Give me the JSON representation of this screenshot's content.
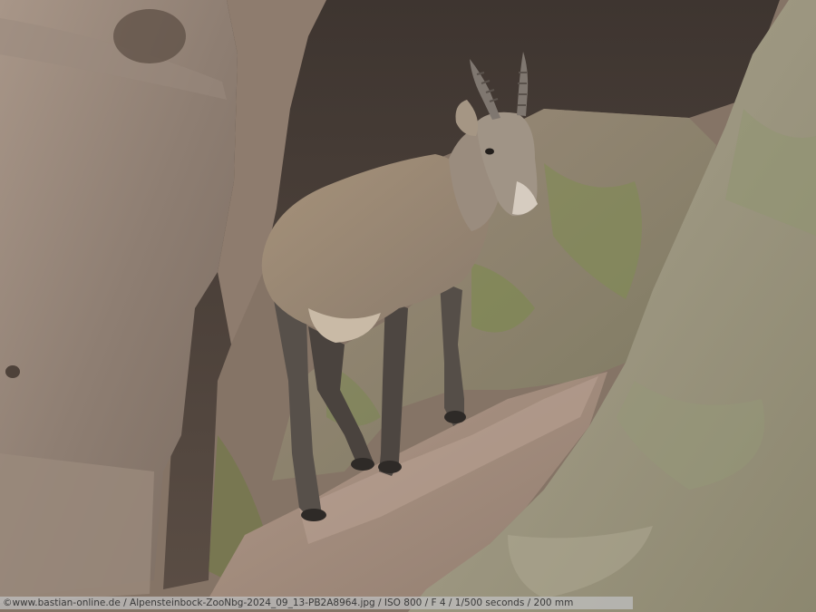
{
  "photo": {
    "subject": "Alpine ibex standing on sandstone rock ledge",
    "caption": "©www.bastian-online.de / Alpensteinbock-ZooNbg-2024_09_13-PB2A8964.jpg / ISO 800 / F 4 / 1/500 seconds / 200 mm"
  },
  "colors": {
    "rock_left": "#948478",
    "rock_dark": "#4a4039",
    "moss": "#8a9a60",
    "rock_right": "#a59f84",
    "ibex_body": "#9c8a74",
    "ibex_legs": "#4a4440"
  }
}
